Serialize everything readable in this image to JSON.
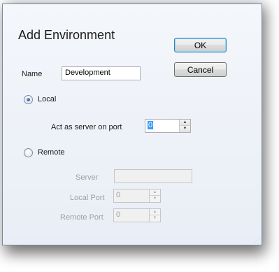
{
  "dialog": {
    "title": "Add Environment",
    "ok_label": "OK",
    "cancel_label": "Cancel"
  },
  "name": {
    "label": "Name",
    "value": "Development"
  },
  "local": {
    "label": "Local",
    "selected": true,
    "server_port_label": "Act as server on port",
    "server_port_value": "0"
  },
  "remote": {
    "label": "Remote",
    "selected": false,
    "server_label": "Server",
    "server_value": "",
    "local_port_label": "Local Port",
    "local_port_value": "0",
    "remote_port_label": "Remote Port",
    "remote_port_value": "0"
  },
  "icons": {
    "spin_up": "triangle-up",
    "spin_down": "triangle-down",
    "resize_grip": "size-grip"
  }
}
